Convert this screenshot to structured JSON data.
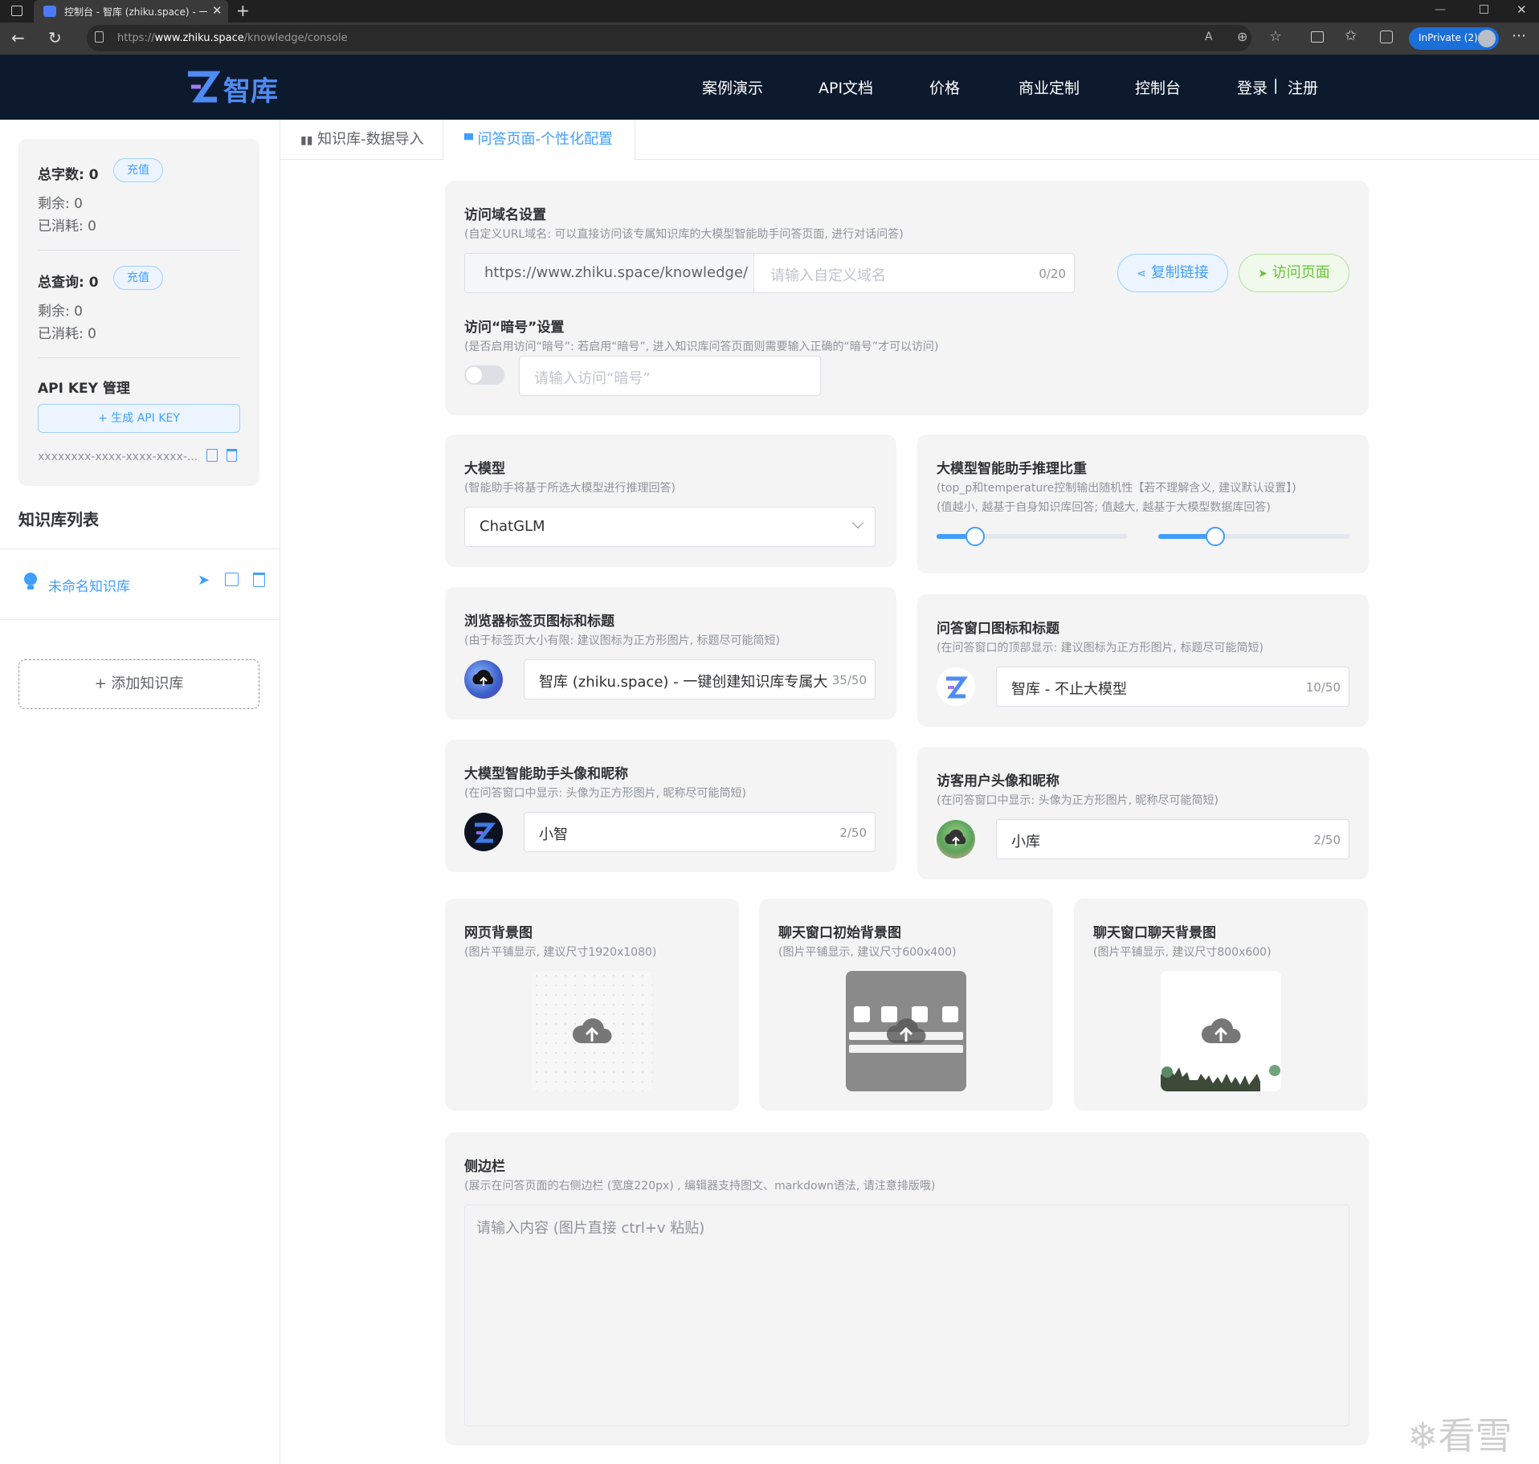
{
  "browser": {
    "tab_title": "控制台 - 智库 (zhiku.space) - 一键",
    "url_prefix": "https://",
    "url_host": "www.zhiku.space",
    "url_path": "/knowledge/console",
    "inprivate_label": "InPrivate (2)"
  },
  "header": {
    "logo_text": "智库",
    "nav": [
      "案例演示",
      "API文档",
      "价格",
      "商业定制",
      "控制台"
    ],
    "login": "登录",
    "separator": "|",
    "register": "注册"
  },
  "sidebar": {
    "words_label": "总字数:",
    "words_value": "0",
    "recharge": "充值",
    "words_remaining": "剩余: 0",
    "words_consumed": "已消耗: 0",
    "queries_label": "总查询:",
    "queries_value": "0",
    "queries_remaining": "剩余: 0",
    "queries_consumed": "已消耗: 0",
    "apikey_title": "API KEY 管理",
    "apikey_button": "+ 生成 API KEY",
    "apikey_masked": "xxxxxxxx-xxxx-xxxx-xxxx-...",
    "kblist_title": "知识库列表",
    "kb_items": [
      "未命名知识库"
    ],
    "add_kb": "+ 添加知识库"
  },
  "tabs": [
    "知识库-数据导入",
    "问答页面-个性化配置"
  ],
  "domain": {
    "title": "访问域名设置",
    "desc": "(自定义URL域名: 可以直接访问该专属知识库的大模型智能助手问答页面, 进行对话问答)",
    "prefix": "https://www.zhiku.space/knowledge/",
    "placeholder": "请输入自定义域名",
    "count": "0/20",
    "copy_btn": "复制链接",
    "visit_btn": "访问页面",
    "pwd_title": "访问“暗号”设置",
    "pwd_desc": "(是否启用访问“暗号”: 若启用“暗号”, 进入知识库问答页面则需要输入正确的“暗号”才可以访问)",
    "pwd_placeholder": "请输入访问“暗号”",
    "pwd_enabled": false
  },
  "model": {
    "title": "大模型",
    "desc": "(智能助手将基于所选大模型进行推理回答)",
    "selected": "ChatGLM"
  },
  "ratio": {
    "title": "大模型智能助手推理比重",
    "desc1": "(top_p和temperature控制输出随机性【若不理解含义, 建议默认设置】)",
    "desc2": "(值越小, 越基于自身知识库回答; 值越大, 越基于大模型数据库回答)",
    "top_p": 0.2,
    "temperature": 0.3
  },
  "browser_tab": {
    "title": "浏览器标签页图标和标题",
    "desc": "(由于标签页大小有限: 建议图标为正方形图片, 标题尽可能简短)",
    "value": "智库 (zhiku.space) - 一键创建知识库专属大模型",
    "count": "35/50"
  },
  "qa_window": {
    "title": "问答窗口图标和标题",
    "desc": "(在问答窗口的顶部显示: 建议图标为正方形图片, 标题尽可能简短)",
    "value": "智库 - 不止大模型",
    "count": "10/50"
  },
  "assistant": {
    "title": "大模型智能助手头像和昵称",
    "desc": "(在问答窗口中显示: 头像为正方形图片, 昵称尽可能简短)",
    "value": "小智",
    "count": "2/50"
  },
  "visitor": {
    "title": "访客用户头像和昵称",
    "desc": "(在问答窗口中显示: 头像为正方形图片, 昵称尽可能简短)",
    "value": "小库",
    "count": "2/50"
  },
  "bg_page": {
    "title": "网页背景图",
    "desc": "(图片平铺显示, 建议尺寸1920x1080)"
  },
  "bg_init": {
    "title": "聊天窗口初始背景图",
    "desc": "(图片平铺显示, 建议尺寸600x400)"
  },
  "bg_chat": {
    "title": "聊天窗口聊天背景图",
    "desc": "(图片平铺显示, 建议尺寸800x600)"
  },
  "side": {
    "title": "侧边栏",
    "desc": "(展示在问答页面的右侧边栏 (宽度220px) , 编辑器支持图文、markdown语法, 请注意排版哦)",
    "placeholder": "请输入内容 (图片直接 ctrl+v 粘贴)"
  },
  "watermark": "看雪",
  "colors": {
    "primary": "#409eff",
    "success": "#67c23a",
    "header_bg": "#0d1a2e"
  }
}
